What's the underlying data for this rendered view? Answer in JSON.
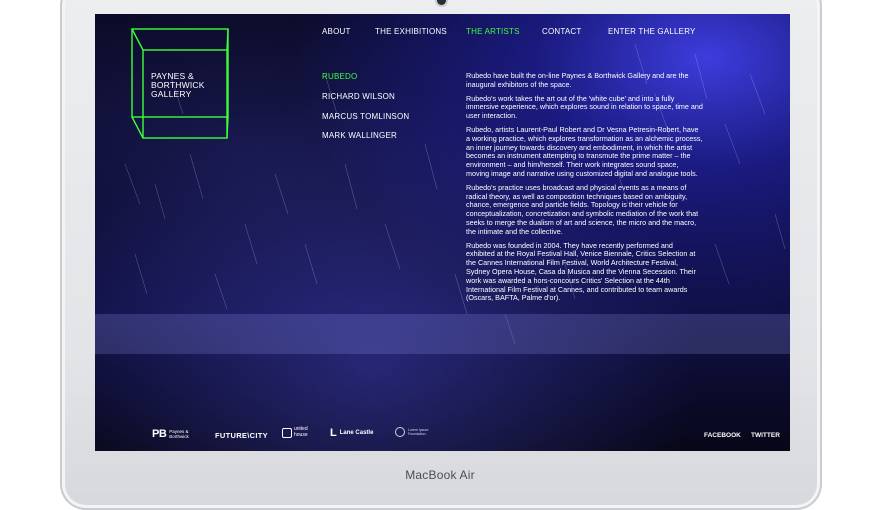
{
  "device": {
    "model_label": "MacBook Air"
  },
  "logo": {
    "lines": [
      "PAYNES &",
      "BORTHWICK",
      "GALLERY"
    ]
  },
  "nav": [
    {
      "label": "ABOUT"
    },
    {
      "label": "THE EXHIBITIONS"
    },
    {
      "label": "THE ARTISTS",
      "active": true
    },
    {
      "label": "CONTACT"
    },
    {
      "label": "ENTER THE GALLERY"
    }
  ],
  "artists": [
    {
      "label": "RUBEDO",
      "active": true
    },
    {
      "label": "RICHARD WILSON"
    },
    {
      "label": "MARCUS TOMLINSON"
    },
    {
      "label": "MARK WALLINGER"
    }
  ],
  "article": {
    "paragraphs": [
      "Rubedo have built the on-line Paynes & Borthwick Gallery and are the inaugural exhibitors of the space.",
      "Rubedo's work takes the art out of the 'white cube' and into a fully immersive experience, which explores sound in relation to space, time and user interaction.",
      "Rubedo, artists Laurent-Paul Robert and Dr Vesna Petresin-Robert, have a working practice, which explores transformation as an alchemic process, an inner journey towards discovery and embodiment, in which the artist becomes an instrument attempting to transmute the prime matter – the environment – and him/herself. Their work integrates sound space, moving image and narrative using customized digital and analogue tools.",
      "Rubedo's practice uses broadcast and physical events as a means of radical theory, as well as composition techniques based on ambiguity, chance, emergence and particle fields. Topology is their vehicle for conceptualization, concretization and symbolic mediation of the work that seeks to merge the dualism of art and science, the micro and the macro, the intimate and the collective.",
      "Rubedo was founded in 2004. They have recently performed and exhibited at the Royal Festival Hall, Venice Biennale, Critics Selection at the Cannes International Film Festival, World Architecture Festival, Sydney Opera House, Casa da Musica and the Vienna Secession. Their work was awarded a hors-concours Critics' Selection at the 44th International Film Festival at Cannes, and contributed to team awards (Oscars, BAFTA, Palme d'or)."
    ]
  },
  "footer": {
    "sponsors": {
      "pb_mark": "PB",
      "pb_text": "Paynes & Borthwick",
      "future_city": "FUTURE\\CITY",
      "united_house": "united house",
      "lane_castle": "Lane Castle",
      "last_logo_text": "Lorem Ipsum Foundation"
    },
    "social": [
      {
        "label": "FACEBOOK"
      },
      {
        "label": "TWITTER"
      }
    ]
  },
  "colors": {
    "accent": "#3cff3c",
    "background": "#0a0a2a",
    "glow": "#4646ff"
  }
}
